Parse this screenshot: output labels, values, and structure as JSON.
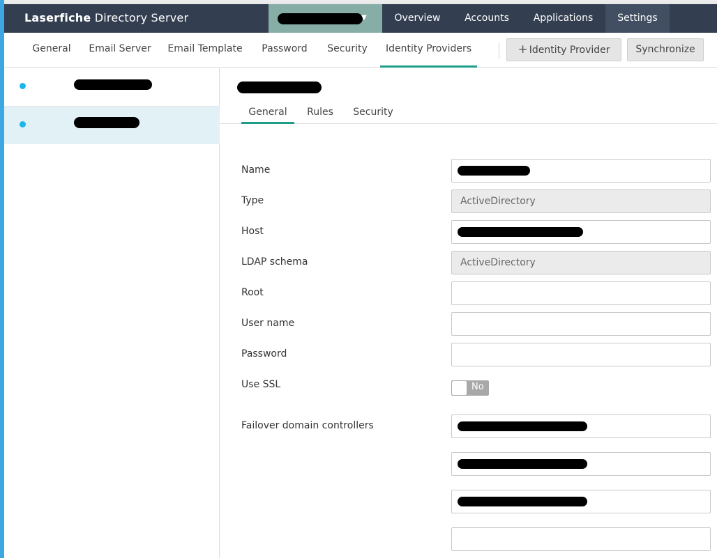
{
  "app": {
    "title_bold": "Laserfiche",
    "title_rest": " Directory Server"
  },
  "top_nav": {
    "overview": "Overview",
    "accounts": "Accounts",
    "applications": "Applications",
    "settings": "Settings"
  },
  "sub_tabs": {
    "general": "General",
    "email_server": "Email Server",
    "email_template": "Email Template",
    "password": "Password",
    "security": "Security",
    "identity_providers": "Identity Providers"
  },
  "actions": {
    "add_idp": "Identity Provider",
    "synchronize": "Synchronize"
  },
  "detail_tabs": {
    "general": "General",
    "rules": "Rules",
    "security": "Security"
  },
  "form": {
    "name_label": "Name",
    "type_label": "Type",
    "type_value": "ActiveDirectory",
    "host_label": "Host",
    "ldap_label": "LDAP schema",
    "ldap_value": "ActiveDirectory",
    "root_label": "Root",
    "root_value": "",
    "username_label": "User name",
    "username_value": "",
    "password_label": "Password",
    "password_value": "",
    "ssl_label": "Use SSL",
    "ssl_value": "No",
    "failover_label": "Failover domain controllers",
    "failover_empty_value": ""
  },
  "colors": {
    "header_bg": "#333e50",
    "selector_bg": "#86ada6",
    "accent_underline": "#1e9e8a",
    "status_dot": "#1cb6e8",
    "selected_row": "#e2f1f5"
  }
}
